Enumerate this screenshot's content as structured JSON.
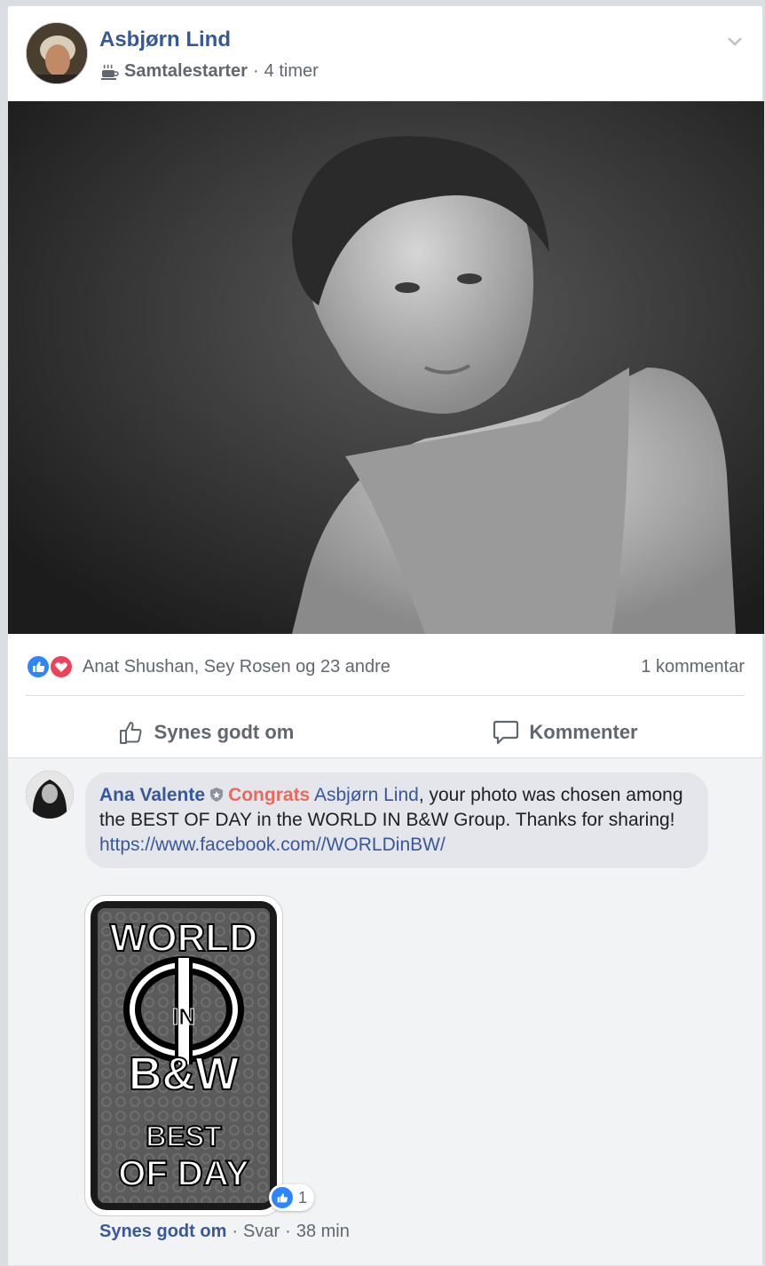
{
  "post": {
    "author": "Asbjørn Lind",
    "badge": "Samtalestarter",
    "separator": "·",
    "time": "4 timer",
    "reactions_text": "Anat Shushan, Sey Rosen og 23 andre",
    "comments_count": "1 kommentar",
    "like_label": "Synes godt om",
    "comment_label": "Kommenter"
  },
  "comment": {
    "author": "Ana Valente",
    "congrats": "Congrats",
    "mention": "Asbjørn Lind",
    "text": ", your photo was chosen among the BEST OF DAY in the WORLD IN B&W Group. Thanks for sharing!",
    "link": "https://www.facebook.com//WORLDinBW/",
    "reaction_count": "1",
    "like_label": "Synes godt om",
    "dot1": "·",
    "reply_label": "Svar",
    "dot2": "·",
    "time": "38 min"
  },
  "sticker": {
    "line1": "WORLD",
    "line2": "IN",
    "line3": "B&W",
    "line4": "BEST",
    "line5": "OF DAY"
  },
  "colors": {
    "link_blue": "#365899",
    "like_blue": "#2d86ff",
    "love_red": "#f0415b",
    "congrats": "#e9695a"
  },
  "icons": [
    "coffee-cup-icon",
    "chevron-down-icon",
    "like-reaction-icon",
    "love-reaction-icon",
    "thumbs-up-icon",
    "comment-icon",
    "shield-icon"
  ]
}
